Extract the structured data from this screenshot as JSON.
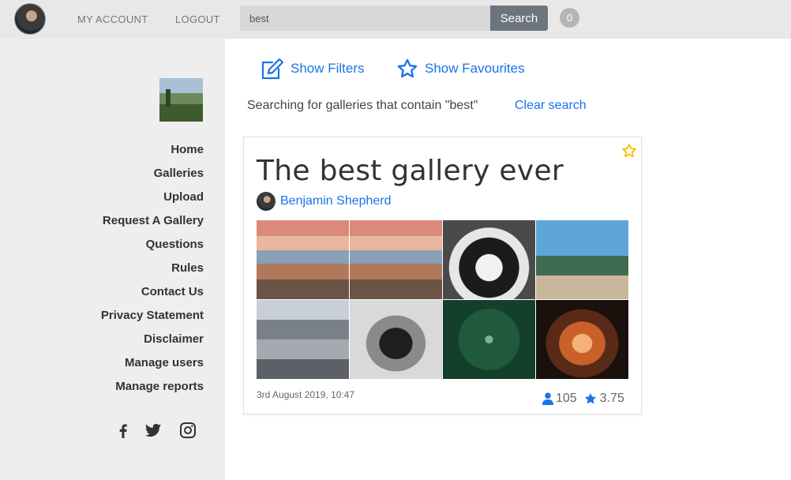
{
  "header": {
    "my_account": "MY ACCOUNT",
    "logout": "LOGOUT",
    "search_value": "best",
    "search_button": "Search",
    "badge_count": "0"
  },
  "sidebar": {
    "items": [
      {
        "label": "Home"
      },
      {
        "label": "Galleries"
      },
      {
        "label": "Upload"
      },
      {
        "label": "Request A Gallery"
      },
      {
        "label": "Questions"
      },
      {
        "label": "Rules"
      },
      {
        "label": "Contact Us"
      },
      {
        "label": "Privacy Statement"
      },
      {
        "label": "Disclaimer"
      },
      {
        "label": "Manage users"
      },
      {
        "label": "Manage reports"
      }
    ],
    "socials": [
      "facebook-icon",
      "twitter-icon",
      "instagram-icon"
    ]
  },
  "main": {
    "show_filters": "Show Filters",
    "show_favourites": "Show Favourites",
    "search_info": "Searching for galleries that contain \"best\"",
    "clear_search": "Clear search"
  },
  "gallery": {
    "title": "The best gallery ever",
    "author": "Benjamin Shepherd",
    "date": "3rd August 2019, 10:47",
    "views": "105",
    "rating": "3.75"
  },
  "colors": {
    "accent": "#1a73e8",
    "favourite_star": "#f2c200",
    "search_button": "#6c757d"
  }
}
